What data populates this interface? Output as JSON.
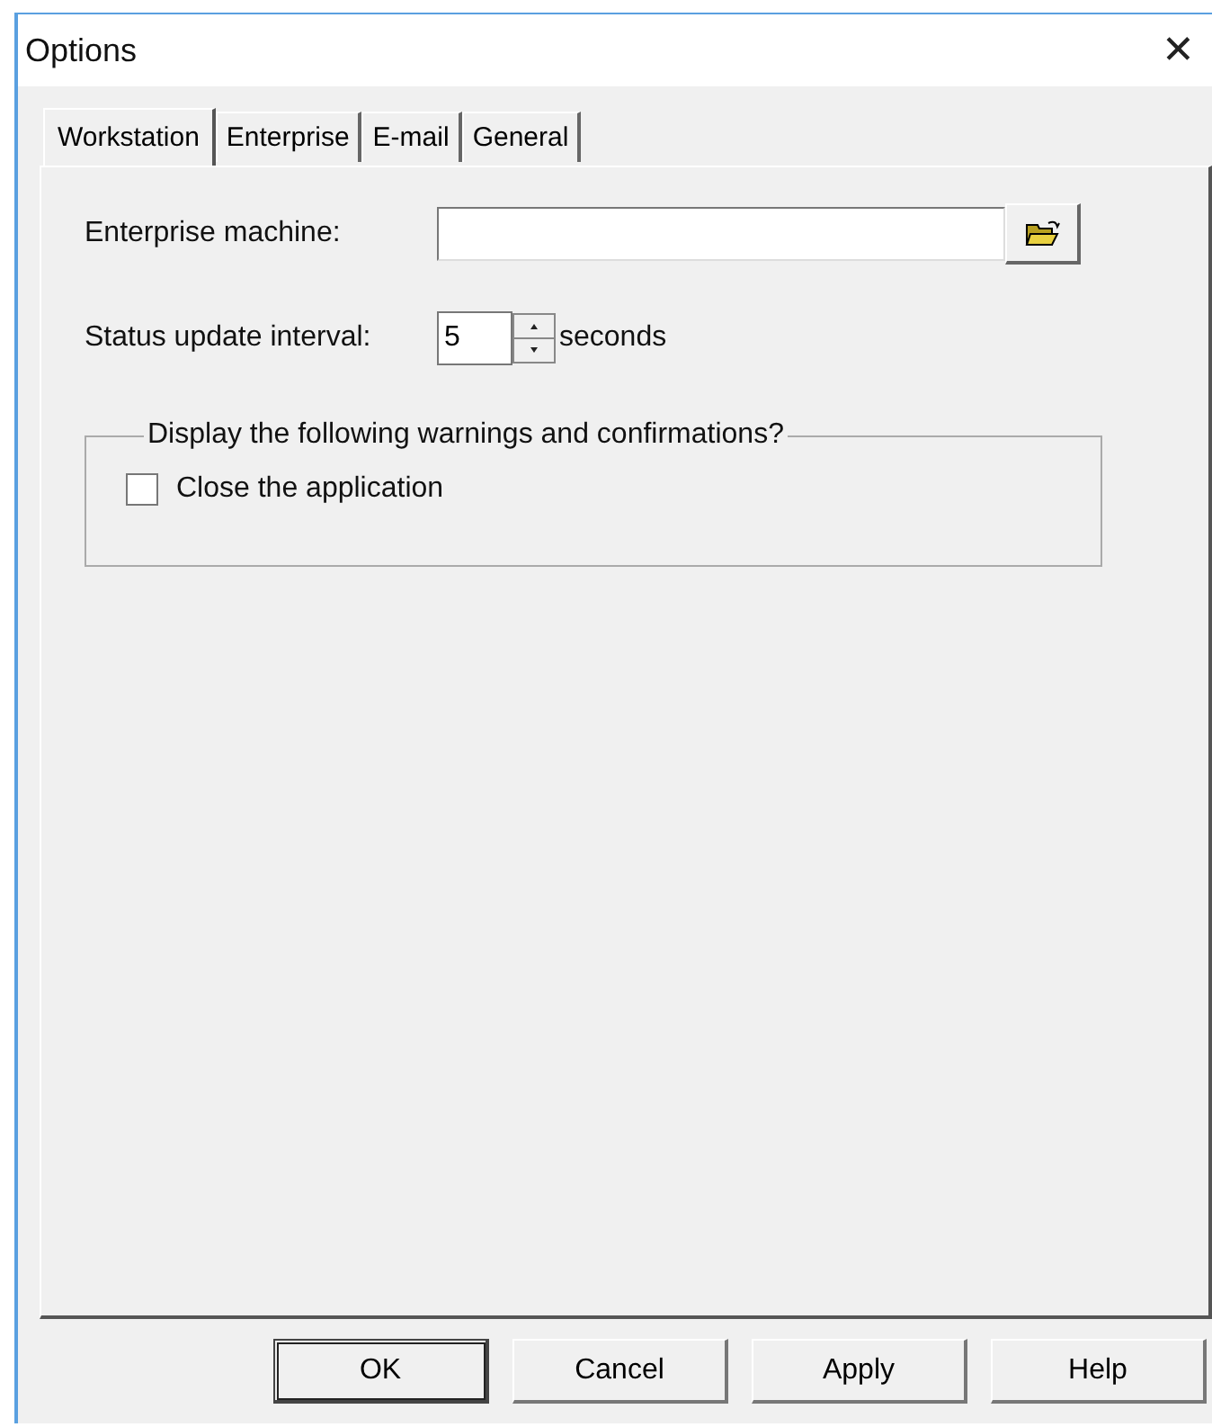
{
  "window": {
    "title": "Options",
    "close": "✕"
  },
  "tabs": [
    {
      "label": "Workstation",
      "selected": true
    },
    {
      "label": "Enterprise",
      "selected": false
    },
    {
      "label": "E-mail",
      "selected": false
    },
    {
      "label": "General",
      "selected": false
    }
  ],
  "enterprise_machine": {
    "label": "Enterprise machine:"
  },
  "status_interval": {
    "label": "Status update interval:",
    "value": "5",
    "unit": "seconds"
  },
  "group": {
    "legend": "Display the following warnings and confirmations?",
    "checkboxes": [
      {
        "label": "Close the application",
        "checked": false
      }
    ]
  },
  "buttons": [
    {
      "label": "OK",
      "default": true
    },
    {
      "label": "Cancel",
      "default": false
    },
    {
      "label": "Apply",
      "default": false
    },
    {
      "label": "Help",
      "default": false
    }
  ]
}
